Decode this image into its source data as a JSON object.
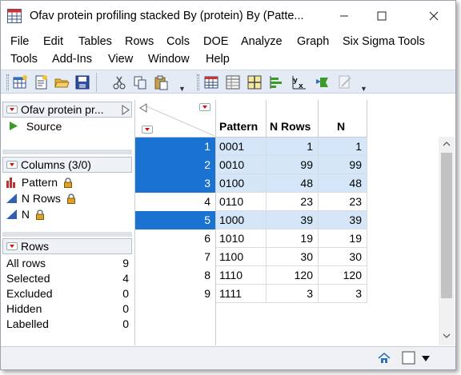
{
  "window": {
    "title": "Ofav protein profiling stacked By (protein) By (Patte...",
    "minimize_icon": "minimize-icon",
    "maximize_icon": "maximize-icon",
    "close_icon": "close-icon"
  },
  "menu": {
    "row1": [
      "File",
      "Edit",
      "Tables",
      "Rows",
      "Cols",
      "DOE",
      "Analyze",
      "Graph",
      "Six Sigma Tools"
    ],
    "row2": [
      "Tools",
      "Add-Ins",
      "View",
      "Window",
      "Help"
    ]
  },
  "toolbar": {
    "icons": [
      "new-data-table-icon",
      "new-script-icon",
      "open-folder-icon",
      "save-icon",
      "cut-icon",
      "copy-icon",
      "paste-icon",
      "data-table-icon",
      "columns-viewer-icon",
      "distribution-icon",
      "fit-y-by-x-icon",
      "fit-model-icon",
      "graph-builder-icon",
      "scripting-icon"
    ]
  },
  "table_panel": {
    "title": "Ofav protein pr...",
    "source_label": "Source"
  },
  "columns_panel": {
    "title": "Columns (3/0)",
    "columns": [
      {
        "name": "Pattern",
        "type_icon": "nominal-icon",
        "locked": true
      },
      {
        "name": "N Rows",
        "type_icon": "continuous-icon",
        "locked": true
      },
      {
        "name": "N",
        "type_icon": "continuous-icon",
        "locked": true
      }
    ]
  },
  "rows_panel": {
    "title": "Rows",
    "stats": [
      {
        "label": "All rows",
        "value": "9"
      },
      {
        "label": "Selected",
        "value": "4"
      },
      {
        "label": "Excluded",
        "value": "0"
      },
      {
        "label": "Hidden",
        "value": "0"
      },
      {
        "label": "Labelled",
        "value": "0"
      }
    ]
  },
  "grid": {
    "headers": [
      "Pattern",
      "N Rows",
      "N"
    ],
    "rows": [
      {
        "num": "1",
        "pattern": "0001",
        "nrows": "1",
        "n": "1",
        "selected": true
      },
      {
        "num": "2",
        "pattern": "0010",
        "nrows": "99",
        "n": "99",
        "selected": true
      },
      {
        "num": "3",
        "pattern": "0100",
        "nrows": "48",
        "n": "48",
        "selected": true
      },
      {
        "num": "4",
        "pattern": "0110",
        "nrows": "23",
        "n": "23",
        "selected": false
      },
      {
        "num": "5",
        "pattern": "1000",
        "nrows": "39",
        "n": "39",
        "selected": true
      },
      {
        "num": "6",
        "pattern": "1010",
        "nrows": "19",
        "n": "19",
        "selected": false
      },
      {
        "num": "7",
        "pattern": "1100",
        "nrows": "30",
        "n": "30",
        "selected": false
      },
      {
        "num": "8",
        "pattern": "1110",
        "nrows": "120",
        "n": "120",
        "selected": false
      },
      {
        "num": "9",
        "pattern": "1111",
        "nrows": "3",
        "n": "3",
        "selected": false
      }
    ]
  },
  "colors": {
    "selected_row_number": "#1a73d0",
    "selected_cell": "#d4e6f7",
    "collapse_triangle": "#d01010"
  }
}
